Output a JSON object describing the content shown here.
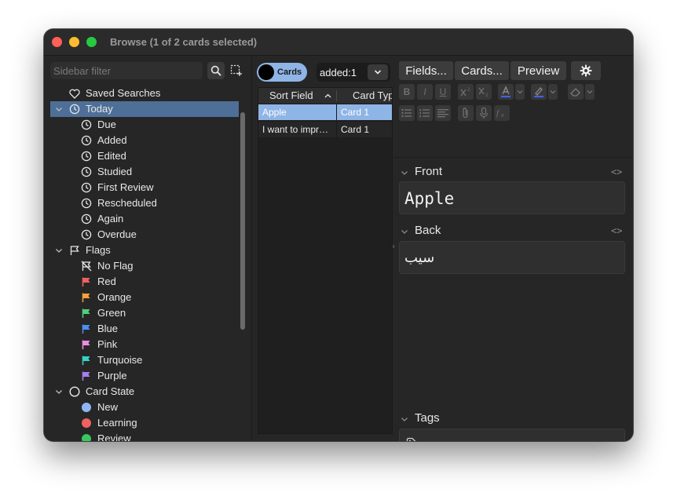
{
  "window": {
    "title": "Browse (1 of 2 cards selected)"
  },
  "sidebar": {
    "filter_placeholder": "Sidebar filter",
    "items": [
      {
        "label": "Saved Searches",
        "level": 0,
        "icon": "heart-icon",
        "chevron": ""
      },
      {
        "label": "Today",
        "level": 0,
        "icon": "clock-icon",
        "chevron": "open",
        "selected": true
      },
      {
        "label": "Due",
        "level": 1,
        "icon": "clock-icon"
      },
      {
        "label": "Added",
        "level": 1,
        "icon": "clock-icon"
      },
      {
        "label": "Edited",
        "level": 1,
        "icon": "clock-icon"
      },
      {
        "label": "Studied",
        "level": 1,
        "icon": "clock-icon"
      },
      {
        "label": "First Review",
        "level": 1,
        "icon": "clock-icon"
      },
      {
        "label": "Rescheduled",
        "level": 1,
        "icon": "clock-icon"
      },
      {
        "label": "Again",
        "level": 1,
        "icon": "clock-icon"
      },
      {
        "label": "Overdue",
        "level": 1,
        "icon": "clock-icon"
      },
      {
        "label": "Flags",
        "level": 0,
        "icon": "flag-outline-icon",
        "chevron": "open"
      },
      {
        "label": "No Flag",
        "level": 1,
        "icon": "no-flag-icon"
      },
      {
        "label": "Red",
        "level": 1,
        "icon": "flag-icon",
        "color": "#f0625e"
      },
      {
        "label": "Orange",
        "level": 1,
        "icon": "flag-icon",
        "color": "#f4a13b"
      },
      {
        "label": "Green",
        "level": 1,
        "icon": "flag-icon",
        "color": "#4fd07b"
      },
      {
        "label": "Blue",
        "level": 1,
        "icon": "flag-icon",
        "color": "#4b8ff4"
      },
      {
        "label": "Pink",
        "level": 1,
        "icon": "flag-icon",
        "color": "#ee8ce0"
      },
      {
        "label": "Turquoise",
        "level": 1,
        "icon": "flag-icon",
        "color": "#34d3c4"
      },
      {
        "label": "Purple",
        "level": 1,
        "icon": "flag-icon",
        "color": "#a97ef0"
      },
      {
        "label": "Card State",
        "level": 0,
        "icon": "circle-outline-icon",
        "chevron": "open"
      },
      {
        "label": "New",
        "level": 1,
        "icon": "dot-icon",
        "color": "#8db7f2"
      },
      {
        "label": "Learning",
        "level": 1,
        "icon": "dot-icon",
        "color": "#f0625e"
      },
      {
        "label": "Review",
        "level": 1,
        "icon": "dot-icon",
        "color": "#3cc460"
      }
    ]
  },
  "cards": {
    "toggle_label": "Cards",
    "search_value": "added:1",
    "columns": [
      "Sort Field",
      "Card Type"
    ],
    "rows": [
      {
        "sort_field": "Apple",
        "card_type": "Card 1",
        "selected": true
      },
      {
        "sort_field": "I want to improve",
        "card_type": "Card 1",
        "selected": false
      }
    ]
  },
  "editor": {
    "buttons": {
      "fields": "Fields...",
      "cards": "Cards...",
      "preview": "Preview"
    },
    "fields": [
      {
        "name": "Front",
        "value": "Apple"
      },
      {
        "name": "Back",
        "value": "سیب"
      }
    ],
    "tags_label": "Tags",
    "html_toggle": "<>",
    "format_buttons": [
      "B",
      "I",
      "U"
    ],
    "colors": {
      "text_color": "#3f63f5",
      "highlight_color": "#3f63f5"
    }
  }
}
